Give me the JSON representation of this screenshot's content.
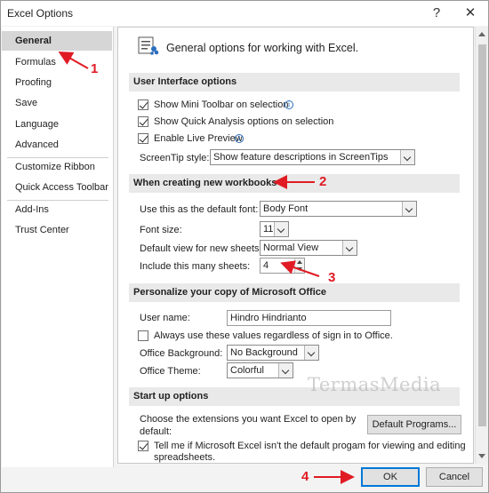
{
  "window": {
    "title": "Excel Options",
    "help_label": "?",
    "close_label": "✕"
  },
  "sidebar": {
    "items": [
      {
        "label": "General"
      },
      {
        "label": "Formulas"
      },
      {
        "label": "Proofing"
      },
      {
        "label": "Save"
      },
      {
        "label": "Language"
      },
      {
        "label": "Advanced"
      },
      {
        "label": "Customize Ribbon"
      },
      {
        "label": "Quick Access Toolbar"
      },
      {
        "label": "Add-Ins"
      },
      {
        "label": "Trust Center"
      }
    ],
    "active": "General"
  },
  "main": {
    "header": "General options for working with Excel.",
    "ui_options": {
      "title": "User Interface options",
      "mini_toolbar": "Show Mini Toolbar on selection",
      "quick_analysis": "Show Quick Analysis options on selection",
      "live_preview": "Enable Live Preview",
      "screentip_label": "ScreenTip style:",
      "screentip_value": "Show feature descriptions in ScreenTips"
    },
    "new_workbooks": {
      "title": "When creating new workbooks",
      "font_label": "Use this as the default font:",
      "font_value": "Body Font",
      "size_label": "Font size:",
      "size_value": "11",
      "view_label": "Default view for new sheets:",
      "view_value": "Normal View",
      "sheets_label": "Include this many sheets:",
      "sheets_value": "4"
    },
    "personalize": {
      "title": "Personalize your copy of Microsoft Office",
      "username_label": "User name:",
      "username_value": "Hindro Hindrianto",
      "always_use": "Always use these values regardless of sign in to Office.",
      "background_label": "Office Background:",
      "background_value": "No Background",
      "theme_label": "Office Theme:",
      "theme_value": "Colorful"
    },
    "startup": {
      "title": "Start up options",
      "extensions_line1": "Choose the extensions you want Excel to open by",
      "extensions_line2": "default:",
      "default_programs": "Default Programs...",
      "tell_me_line1": "Tell me if Microsoft Excel isn't the default progam for viewing and editing",
      "tell_me_line2": "spreadsheets."
    }
  },
  "footer": {
    "ok": "OK",
    "cancel": "Cancel"
  },
  "watermark": "TermasMedia",
  "annotations": [
    "1",
    "2",
    "3",
    "4"
  ],
  "colors": {
    "annotation": "#e01b24",
    "default_button_border": "#0078d7"
  }
}
